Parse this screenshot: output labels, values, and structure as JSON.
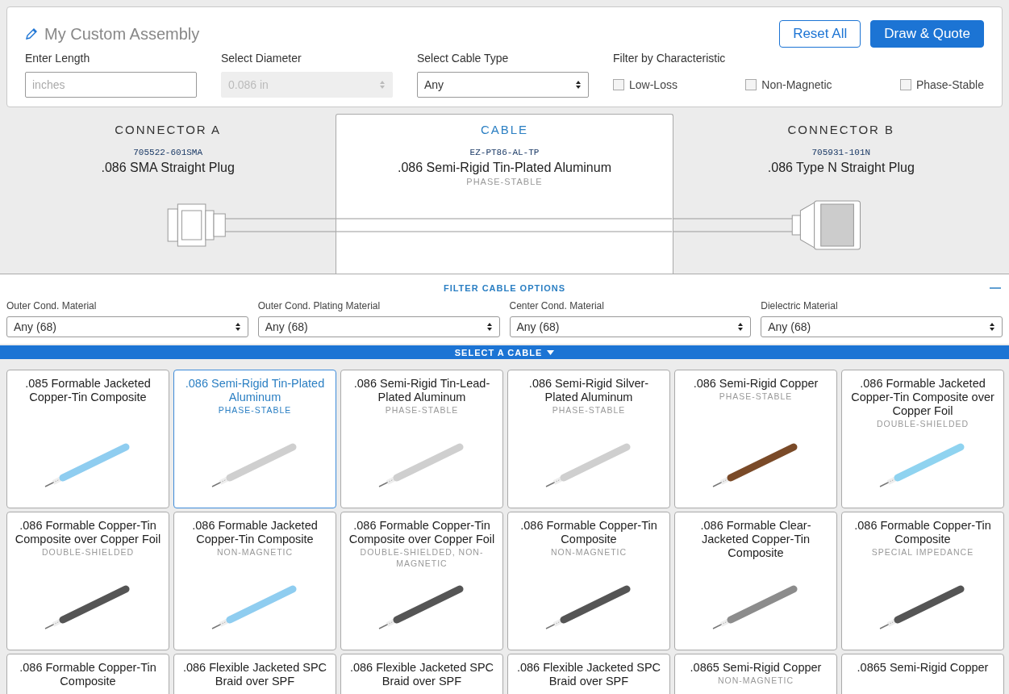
{
  "assembly": {
    "title": "My Custom Assembly",
    "buttons": [
      {
        "label": "Reset All",
        "kind": "secondary"
      },
      {
        "label": "Draw & Quote",
        "kind": "primary"
      }
    ],
    "fields": [
      {
        "label": "Enter Length",
        "kind": "text",
        "placeholder": "inches"
      },
      {
        "label": "Select Diameter",
        "kind": "select",
        "value": "0.086 in",
        "disabled": true
      },
      {
        "label": "Select Cable Type",
        "kind": "select",
        "value": "Any",
        "disabled": false
      }
    ],
    "characteristic_filter": {
      "label": "Filter by Characteristic",
      "options": [
        {
          "label": "Low-Loss",
          "checked": false
        },
        {
          "label": "Non-Magnetic",
          "checked": false
        },
        {
          "label": "Phase-Stable",
          "checked": false
        }
      ]
    }
  },
  "parts": [
    {
      "kind": "connector-sma",
      "heading": "CONNECTOR A",
      "part_number": "705522-601SMA",
      "name": ".086 SMA Straight Plug",
      "selected": false
    },
    {
      "kind": "cable",
      "heading": "CABLE",
      "part_number": "EZ-PT86-AL-TP",
      "name": ".086 Semi-Rigid Tin-Plated Aluminum",
      "tag": "PHASE-STABLE",
      "selected": true
    },
    {
      "kind": "connector-n",
      "heading": "CONNECTOR B",
      "part_number": "705931-101N",
      "name": ".086 Type N Straight Plug",
      "selected": false
    }
  ],
  "cable_filters": {
    "title": "FILTER CABLE OPTIONS",
    "expanded": true,
    "filters": [
      {
        "label": "Outer Cond. Material",
        "value": "Any (68)"
      },
      {
        "label": "Outer Cond. Plating Material",
        "value": "Any (68)"
      },
      {
        "label": "Center Cond. Material",
        "value": "Any (68)"
      },
      {
        "label": "Dielectric Material",
        "value": "Any (68)"
      }
    ]
  },
  "cable_list": {
    "title": "SELECT A CABLE",
    "cables": [
      {
        "title": ".085 Formable Jacketed Copper-Tin Composite",
        "color": "#8fcdf0",
        "selected": false
      },
      {
        "title": ".086 Semi-Rigid Tin-Plated Aluminum",
        "tag": "PHASE-STABLE",
        "color": "#cfcfcf",
        "selected": true
      },
      {
        "title": ".086 Semi-Rigid Tin-Lead-Plated Aluminum",
        "tag": "PHASE-STABLE",
        "color": "#cfcfcf",
        "selected": false
      },
      {
        "title": ".086 Semi-Rigid Silver-Plated Aluminum",
        "tag": "PHASE-STABLE",
        "color": "#cfcfcf",
        "selected": false
      },
      {
        "title": ".086 Semi-Rigid Copper",
        "tag": "PHASE-STABLE",
        "color": "#7a4a28",
        "selected": false
      },
      {
        "title": ".086 Formable Jacketed Copper-Tin Composite over Copper Foil",
        "tag": "DOUBLE-SHIELDED",
        "color": "#8fd3f0",
        "selected": false
      },
      {
        "title": ".086 Formable Copper-Tin Composite over Copper Foil",
        "tag": "DOUBLE-SHIELDED",
        "color": "#555555",
        "selected": false
      },
      {
        "title": ".086 Formable Jacketed Copper-Tin Composite",
        "tag": "NON-MAGNETIC",
        "color": "#8fcdf0",
        "selected": false
      },
      {
        "title": ".086 Formable Copper-Tin Composite over Copper Foil",
        "tag": "DOUBLE-SHIELDED, NON-MAGNETIC",
        "color": "#555555",
        "selected": false
      },
      {
        "title": ".086 Formable Copper-Tin Composite",
        "tag": "NON-MAGNETIC",
        "color": "#555555",
        "selected": false
      },
      {
        "title": ".086 Formable Clear-Jacketed Copper-Tin Composite",
        "color": "#8c8c8c",
        "selected": false
      },
      {
        "title": ".086 Formable Copper-Tin Composite",
        "tag": "SPECIAL IMPEDANCE",
        "color": "#555555",
        "selected": false
      },
      {
        "title": ".086 Formable Copper-Tin Composite",
        "selected": false
      },
      {
        "title": ".086 Flexible Jacketed SPC Braid over SPF",
        "selected": false
      },
      {
        "title": ".086 Flexible Jacketed SPC Braid over SPF",
        "selected": false
      },
      {
        "title": ".086 Flexible Jacketed SPC Braid over SPF",
        "selected": false
      },
      {
        "title": ".0865 Semi-Rigid Copper",
        "tag": "NON-MAGNETIC",
        "selected": false
      },
      {
        "title": ".0865 Semi-Rigid Copper",
        "selected": false
      }
    ]
  }
}
